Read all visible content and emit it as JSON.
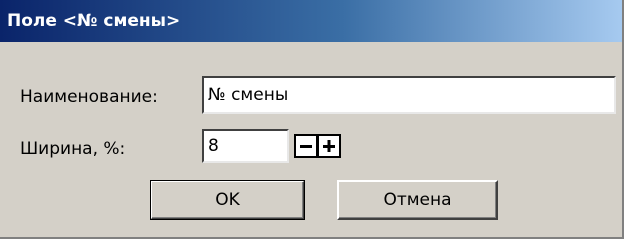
{
  "window": {
    "title": "Поле <№ смены>"
  },
  "form": {
    "name_label": "Наименование:",
    "name_value": "№ смены",
    "width_label": "Ширина, %:",
    "width_value": "8",
    "minus_symbol": "−",
    "plus_symbol": "+"
  },
  "buttons": {
    "ok_label": "OK",
    "cancel_label": "Отмена"
  },
  "colors": {
    "dialog_bg": "#d4d0c8",
    "titlebar_start": "#0a246a",
    "titlebar_end": "#a6caf0"
  }
}
